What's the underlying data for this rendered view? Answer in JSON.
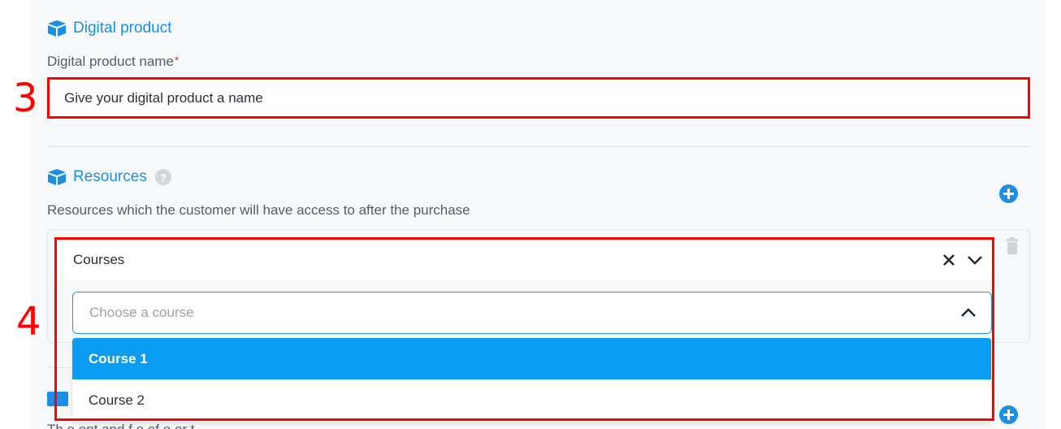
{
  "digital_product": {
    "section_title": "Digital product",
    "name_label": "Digital product name",
    "required_mark": "*",
    "name_value": "Give your digital product a name"
  },
  "resources": {
    "section_title": "Resources",
    "help_glyph": "?",
    "description": "Resources which the customer will have access to after the purchase",
    "type_value": "Courses",
    "course_placeholder": "Choose a course",
    "options": [
      "Course 1",
      "Course 2"
    ],
    "highlighted_option": "Course 1"
  },
  "next_section": {
    "description_partial": "Th  e  ent  and  f  e   of  e  er  t"
  },
  "annotations": {
    "label_3": "3",
    "label_4": "4"
  },
  "icons": [
    "box-icon",
    "help-icon",
    "add-icon",
    "clear-icon",
    "chevron-down-icon",
    "chevron-up-icon",
    "trash-icon",
    "card-icon"
  ],
  "colors": {
    "accent": "#1a8fe3",
    "option_highlight": "#0a9cf0",
    "annotation": "#ff0000",
    "required": "#e53935"
  }
}
